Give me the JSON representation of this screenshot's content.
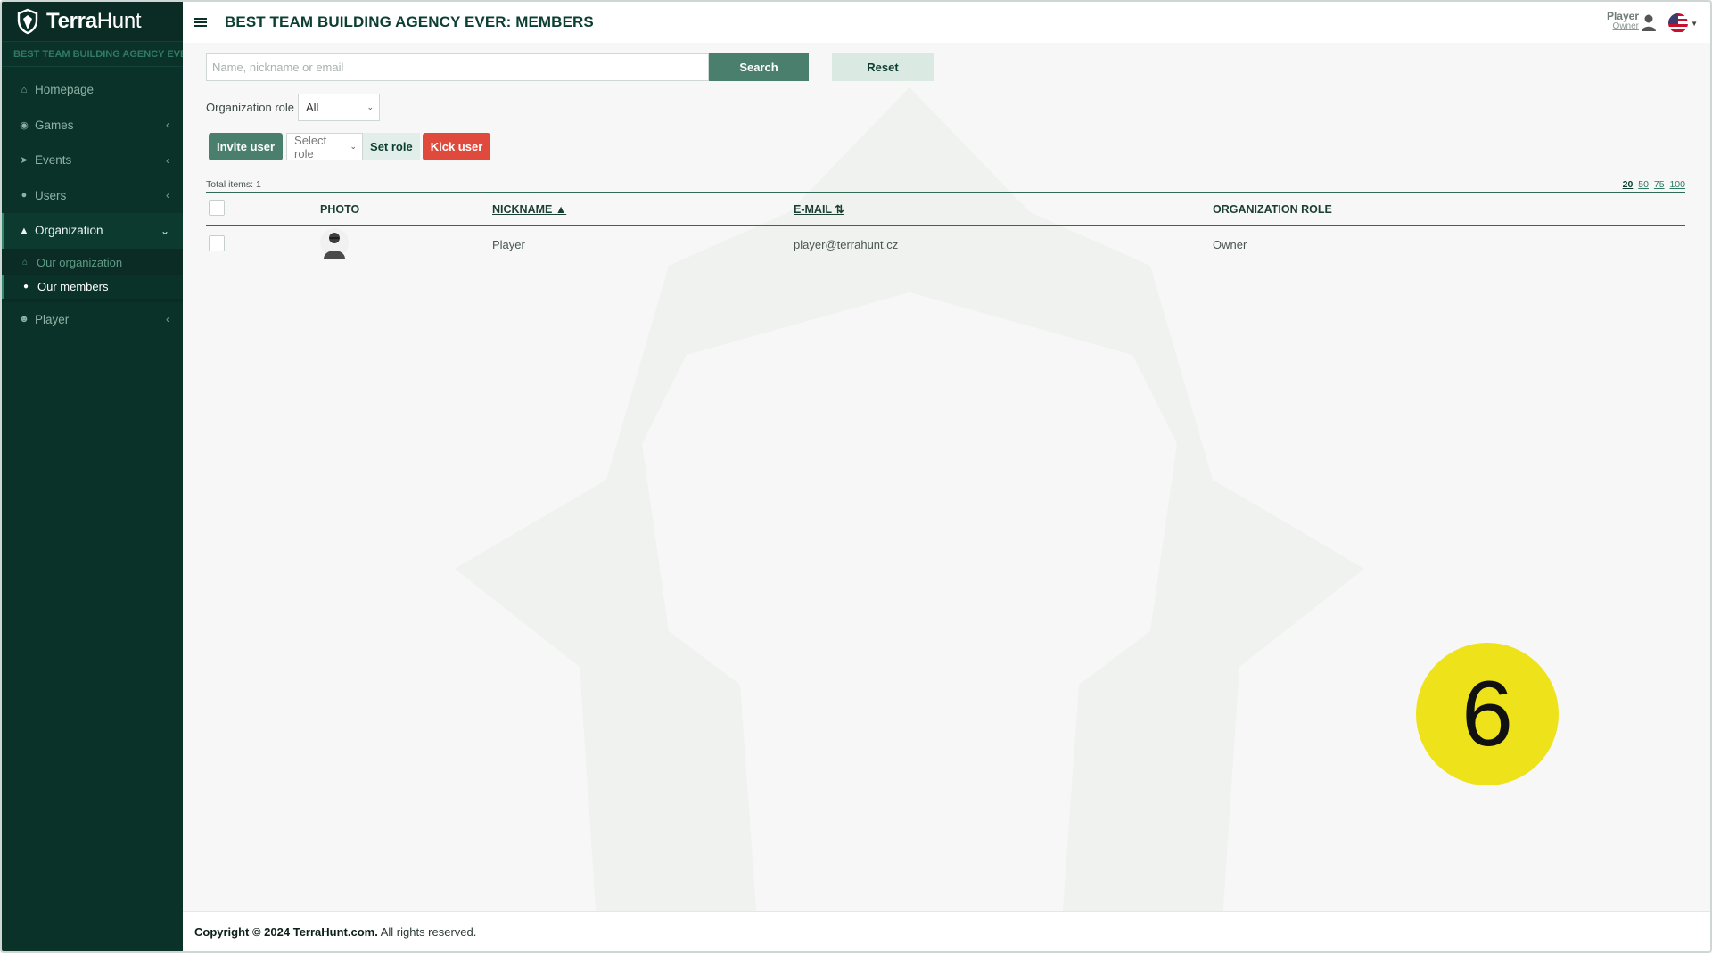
{
  "app": {
    "logo_text_bold": "Terra",
    "logo_text_light": "Hunt",
    "org_strip": "BEST TEAM BUILDING AGENCY EVER",
    "page_title": "BEST TEAM BUILDING AGENCY EVER: MEMBERS"
  },
  "sidebar": {
    "items": [
      {
        "label": "Homepage",
        "icon": "home-icon",
        "has_chevron": false
      },
      {
        "label": "Games",
        "icon": "gamepad-icon",
        "has_chevron": true
      },
      {
        "label": "Events",
        "icon": "rocket-icon",
        "has_chevron": true
      },
      {
        "label": "Users",
        "icon": "users-icon",
        "has_chevron": true
      },
      {
        "label": "Organization",
        "icon": "sitemap-icon",
        "has_chevron": true,
        "open": true
      },
      {
        "label": "Player",
        "icon": "user-icon",
        "has_chevron": true
      }
    ],
    "sub_items": [
      {
        "label": "Our organization",
        "icon": "home-icon"
      },
      {
        "label": "Our members",
        "icon": "users-icon",
        "active": true
      }
    ]
  },
  "header": {
    "user_name": "Player",
    "user_role": "Owner",
    "language": "English (US flag)"
  },
  "search": {
    "placeholder": "Name, nickname or email",
    "value": "",
    "search_label": "Search",
    "reset_label": "Reset"
  },
  "filter": {
    "role_label": "Organization role",
    "role_value": "All"
  },
  "actions": {
    "invite_label": "Invite user",
    "select_role_placeholder": "Select role",
    "set_role_label": "Set role",
    "kick_label": "Kick user"
  },
  "table": {
    "total_label": "Total items: 1",
    "page_sizes": [
      "20",
      "50",
      "75",
      "100"
    ],
    "current_page_size": "20",
    "columns": {
      "photo": "PHOTO",
      "nickname": "NICKNAME ▲",
      "email": "E-MAIL ⇅",
      "role": "ORGANIZATION ROLE"
    },
    "rows": [
      {
        "nickname": "Player",
        "email": "player@terrahunt.cz",
        "role": "Owner"
      }
    ]
  },
  "footer": {
    "copyright_bold": "Copyright © 2024 TerraHunt.com.",
    "copyright_rest": " All rights reserved."
  },
  "overlay": {
    "badge_number": "6",
    "badge_color": "#eee21a"
  },
  "colors": {
    "sidebar_bg": "#0b3229",
    "accent": "#4a7f6e",
    "danger": "#e04a3c",
    "title": "#0c3f31"
  }
}
